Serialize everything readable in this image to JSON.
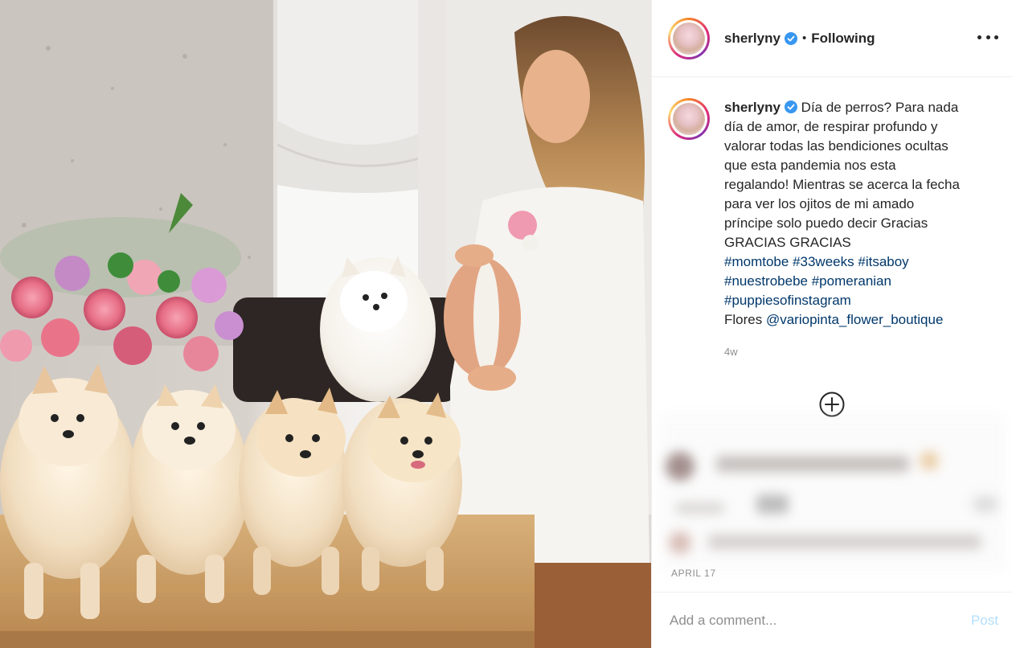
{
  "post": {
    "image_alt": "",
    "username": "sherlyny",
    "follow_dot": "•",
    "follow_status": "Following",
    "caption_lines": [
      "Día de perros? Para nada",
      "día de amor, de respirar profundo y",
      "valorar todas las bendiciones ocultas",
      "que esta pandemia nos esta",
      "regalando! Mientras se acerca la fecha",
      "para ver los ojitos de mi amado",
      "príncipe solo puedo decir Gracias",
      "GRACIAS GRACIAS"
    ],
    "hashtags_line1": [
      "#momtobe",
      "#33weeks",
      "#itsaboy"
    ],
    "hashtags_line2": [
      "#nuestrobebe",
      "#pomeranian"
    ],
    "hashtags_line3": [
      "#puppiesofinstagram"
    ],
    "credit_prefix": "Flores",
    "credit_mention": "@variopinta_flower_boutique",
    "time_ago": "4w",
    "date": "APRIL 17"
  },
  "comment_box": {
    "placeholder": "Add a comment...",
    "post_label": "Post"
  },
  "icons": {
    "verified": "verified-badge-icon",
    "more": "more-options-icon",
    "load_more": "plus-circle-icon"
  },
  "colors": {
    "link": "#00376b",
    "verified": "#3897f0",
    "post_disabled": "#b2dffc",
    "muted": "#8e8e8e"
  }
}
